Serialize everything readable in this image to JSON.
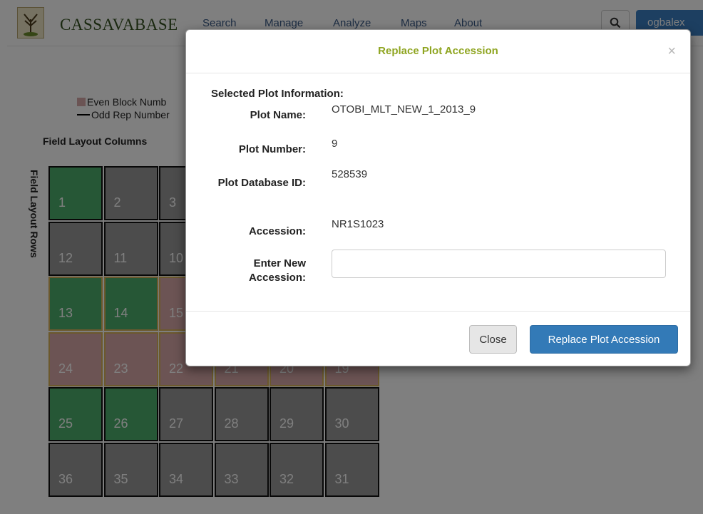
{
  "navbar": {
    "brand": "CASSAVABASE",
    "items": [
      "Search",
      "Manage",
      "Analyze",
      "Maps",
      "About"
    ],
    "search_icon": "search-icon",
    "user": "ogbalex"
  },
  "layout": {
    "legend_even_block": "Even Block Numb",
    "legend_odd_rep": "Odd Rep Number",
    "columns_label": "Field Layout Columns",
    "rows_label": "Field Layout Rows",
    "plots": [
      {
        "label": "1",
        "style": "green"
      },
      {
        "label": "2",
        "style": "gray"
      },
      {
        "label": "3",
        "style": "gray"
      },
      {
        "label": "12",
        "style": "gray"
      },
      {
        "label": "11",
        "style": "gray"
      },
      {
        "label": "10",
        "style": "gray"
      },
      {
        "label": "13",
        "style": "green-y"
      },
      {
        "label": "14",
        "style": "green-y"
      },
      {
        "label": "15",
        "style": "pink"
      },
      {
        "label": "24",
        "style": "pink"
      },
      {
        "label": "23",
        "style": "pink"
      },
      {
        "label": "22",
        "style": "pink"
      },
      {
        "label": "21",
        "style": "pink"
      },
      {
        "label": "20",
        "style": "pink"
      },
      {
        "label": "19",
        "style": "pink"
      },
      {
        "label": "25",
        "style": "green"
      },
      {
        "label": "26",
        "style": "green"
      },
      {
        "label": "27",
        "style": "gray"
      },
      {
        "label": "28",
        "style": "gray"
      },
      {
        "label": "29",
        "style": "gray"
      },
      {
        "label": "30",
        "style": "gray"
      },
      {
        "label": "36",
        "style": "gray"
      },
      {
        "label": "35",
        "style": "gray"
      },
      {
        "label": "34",
        "style": "gray"
      },
      {
        "label": "33",
        "style": "gray"
      },
      {
        "label": "32",
        "style": "gray"
      },
      {
        "label": "31",
        "style": "gray"
      }
    ],
    "colors": {
      "green": "#4caf6d",
      "gray": "#999999",
      "pink": "#d9a9a9",
      "block_border": "#d8b25a"
    }
  },
  "modal": {
    "title": "Replace Plot Accession",
    "close_symbol": "×",
    "section_title": "Selected Plot Information:",
    "fields": [
      {
        "label": "Plot Name:",
        "value": "OTOBI_MLT_NEW_1_2013_9"
      },
      {
        "label": "Plot Number:",
        "value": "9"
      },
      {
        "label": "Plot Database ID:",
        "value": "528539"
      },
      {
        "label": "Accession:",
        "value": "NR1S1023"
      }
    ],
    "new_accession_label": "Enter New Accession:",
    "new_accession_value": "",
    "close_button": "Close",
    "replace_button": "Replace Plot Accession",
    "colors": {
      "title": "#8fa521",
      "primary": "#337ab7"
    }
  }
}
